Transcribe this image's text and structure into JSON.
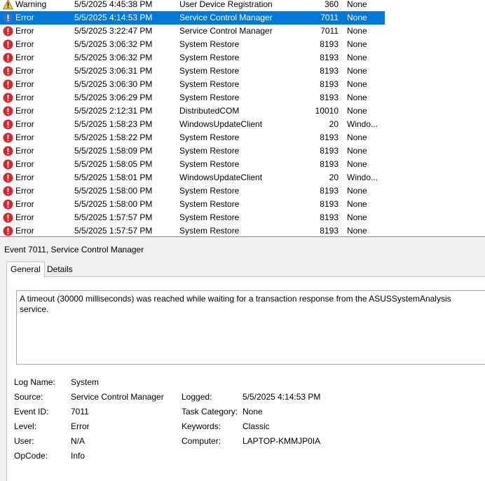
{
  "events": [
    {
      "level": "Warning",
      "icon": "warning-icon",
      "date": "5/5/2025 4:45:38 PM",
      "source": "User Device Registration",
      "id": "360",
      "task": "None"
    },
    {
      "level": "Error",
      "icon": "error-icon",
      "date": "5/5/2025 4:14:53 PM",
      "source": "Service Control Manager",
      "id": "7011",
      "task": "None",
      "selected": true
    },
    {
      "level": "Error",
      "icon": "error-icon",
      "date": "5/5/2025 3:22:47 PM",
      "source": "Service Control Manager",
      "id": "7011",
      "task": "None"
    },
    {
      "level": "Error",
      "icon": "error-icon",
      "date": "5/5/2025 3:06:32 PM",
      "source": "System Restore",
      "id": "8193",
      "task": "None"
    },
    {
      "level": "Error",
      "icon": "error-icon",
      "date": "5/5/2025 3:06:32 PM",
      "source": "System Restore",
      "id": "8193",
      "task": "None"
    },
    {
      "level": "Error",
      "icon": "error-icon",
      "date": "5/5/2025 3:06:31 PM",
      "source": "System Restore",
      "id": "8193",
      "task": "None"
    },
    {
      "level": "Error",
      "icon": "error-icon",
      "date": "5/5/2025 3:06:30 PM",
      "source": "System Restore",
      "id": "8193",
      "task": "None"
    },
    {
      "level": "Error",
      "icon": "error-icon",
      "date": "5/5/2025 3:06:29 PM",
      "source": "System Restore",
      "id": "8193",
      "task": "None"
    },
    {
      "level": "Error",
      "icon": "error-icon",
      "date": "5/5/2025 2:12:31 PM",
      "source": "DistributedCOM",
      "id": "10010",
      "task": "None"
    },
    {
      "level": "Error",
      "icon": "error-icon",
      "date": "5/5/2025 1:58:23 PM",
      "source": "WindowsUpdateClient",
      "id": "20",
      "task": "Windo..."
    },
    {
      "level": "Error",
      "icon": "error-icon",
      "date": "5/5/2025 1:58:22 PM",
      "source": "System Restore",
      "id": "8193",
      "task": "None"
    },
    {
      "level": "Error",
      "icon": "error-icon",
      "date": "5/5/2025 1:58:09 PM",
      "source": "System Restore",
      "id": "8193",
      "task": "None"
    },
    {
      "level": "Error",
      "icon": "error-icon",
      "date": "5/5/2025 1:58:05 PM",
      "source": "System Restore",
      "id": "8193",
      "task": "None"
    },
    {
      "level": "Error",
      "icon": "error-icon",
      "date": "5/5/2025 1:58:01 PM",
      "source": "WindowsUpdateClient",
      "id": "20",
      "task": "Windo..."
    },
    {
      "level": "Error",
      "icon": "error-icon",
      "date": "5/5/2025 1:58:00 PM",
      "source": "System Restore",
      "id": "8193",
      "task": "None"
    },
    {
      "level": "Error",
      "icon": "error-icon",
      "date": "5/5/2025 1:58:00 PM",
      "source": "System Restore",
      "id": "8193",
      "task": "None"
    },
    {
      "level": "Error",
      "icon": "error-icon",
      "date": "5/5/2025 1:57:57 PM",
      "source": "System Restore",
      "id": "8193",
      "task": "None"
    },
    {
      "level": "Error",
      "icon": "error-icon",
      "date": "5/5/2025 1:57:57 PM",
      "source": "System Restore",
      "id": "8193",
      "task": "None"
    }
  ],
  "colors": {
    "selection": "#0078d7",
    "error": "#d9262b",
    "warning": "#f2c12e",
    "selected_icon": "#3d6fc0"
  },
  "detail": {
    "title": "Event 7011, Service Control Manager",
    "tabs": {
      "general": "General",
      "details": "Details"
    },
    "description": "A timeout (30000 milliseconds) was reached while waiting for a transaction response from the ASUSSystemAnalysis service.",
    "fields": {
      "log_name": {
        "label": "Log Name:",
        "value": "System"
      },
      "source": {
        "label": "Source:",
        "value": "Service Control Manager"
      },
      "logged": {
        "label": "Logged:",
        "value": "5/5/2025 4:14:53 PM"
      },
      "event_id": {
        "label": "Event ID:",
        "value": "7011"
      },
      "task_category": {
        "label": "Task Category:",
        "value": "None"
      },
      "level": {
        "label": "Level:",
        "value": "Error"
      },
      "keywords": {
        "label": "Keywords:",
        "value": "Classic"
      },
      "user": {
        "label": "User:",
        "value": "N/A"
      },
      "computer": {
        "label": "Computer:",
        "value": "LAPTOP-KMMJP0IA"
      },
      "opcode": {
        "label": "OpCode:",
        "value": "Info"
      }
    }
  }
}
